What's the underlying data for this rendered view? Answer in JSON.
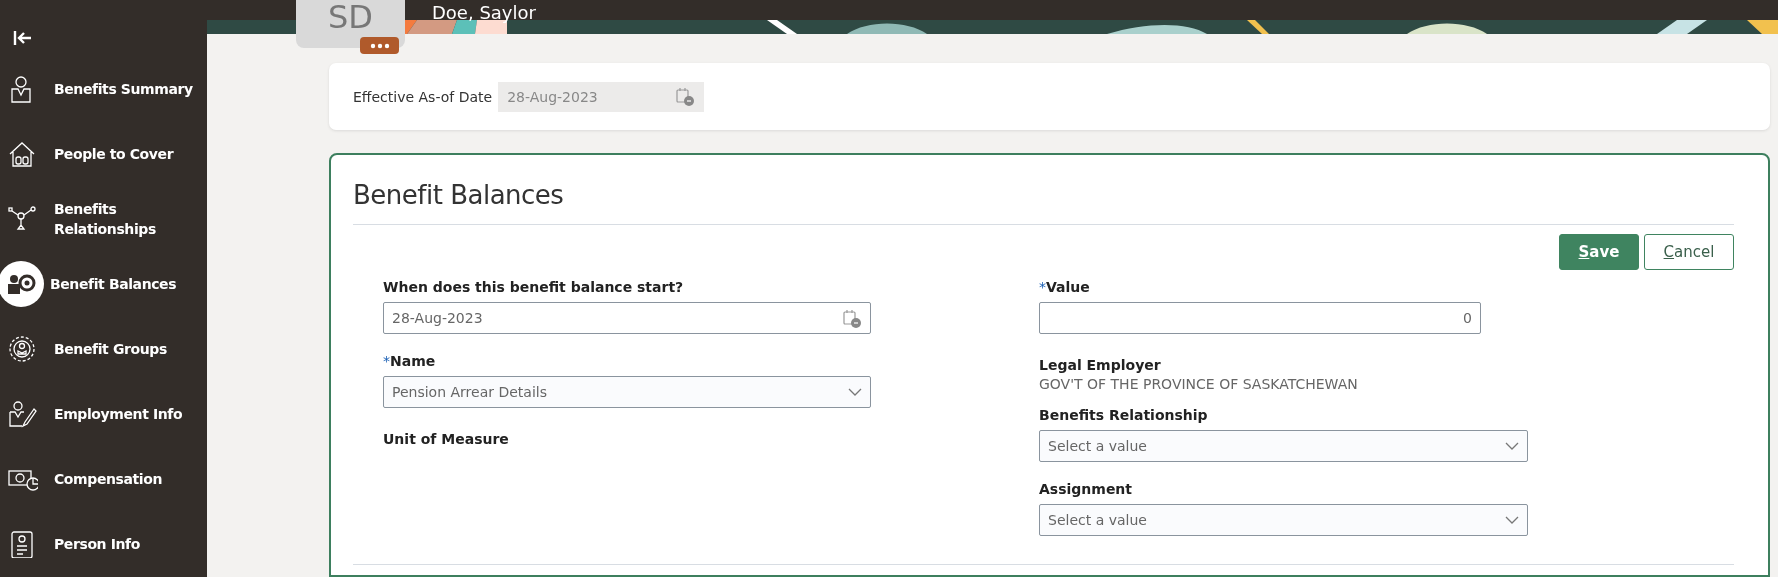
{
  "header": {
    "avatar_initials": "SD",
    "person_name": "Doe, Saylor"
  },
  "sidebar": {
    "items": [
      {
        "label": "Benefits Summary",
        "selected": false
      },
      {
        "label": "People to Cover",
        "selected": false
      },
      {
        "label": "Benefits Relationships",
        "selected": false
      },
      {
        "label": "Benefit Balances",
        "selected": true
      },
      {
        "label": "Benefit Groups",
        "selected": false
      },
      {
        "label": "Employment Info",
        "selected": false
      },
      {
        "label": "Compensation",
        "selected": false
      },
      {
        "label": "Person Info",
        "selected": false
      }
    ]
  },
  "effective_date": {
    "label": "Effective As-of Date",
    "value": "28-Aug-2023",
    "disabled": true
  },
  "panel": {
    "title": "Benefit Balances",
    "buttons": [
      {
        "label": "Save",
        "kind": "primary",
        "mnemonic": true
      },
      {
        "label": "Cancel",
        "kind": "secondary",
        "mnemonic": true
      }
    ],
    "left_fields": [
      {
        "kind": "date",
        "label": "When does this benefit balance start?",
        "value": "28-Aug-2023"
      },
      {
        "kind": "select",
        "label": "Name",
        "required_mark": "*",
        "value": "Pension Arrear Details"
      },
      {
        "kind": "display",
        "label": "Unit of Measure"
      }
    ],
    "right_fields": [
      {
        "kind": "number",
        "label": "Value",
        "required_mark": "*",
        "value": "0"
      },
      {
        "kind": "display",
        "label": "Legal Employer",
        "value": "GOV'T OF THE PROVINCE OF SASKATCHEWAN"
      },
      {
        "kind": "select",
        "label": "Benefits Relationship",
        "placeholder": "Select a value"
      },
      {
        "kind": "select",
        "label": "Assignment",
        "placeholder": "Select a value"
      }
    ]
  }
}
